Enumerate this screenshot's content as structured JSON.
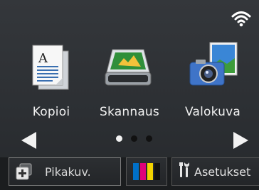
{
  "status": {
    "wifi_icon": "wifi-icon"
  },
  "apps": [
    {
      "label": "Kopioi",
      "icon": "copy-icon"
    },
    {
      "label": "Skannaus",
      "icon": "scanner-icon"
    },
    {
      "label": "Valokuva",
      "icon": "photo-camera-icon"
    }
  ],
  "pager": {
    "pages": 3,
    "current": 1
  },
  "bottom": {
    "shortcut_label": "Pikakuv.",
    "ink_colors": [
      "#0070c8",
      "#e0007a",
      "#f2d200",
      "#111111"
    ],
    "settings_label": "Asetukset"
  }
}
